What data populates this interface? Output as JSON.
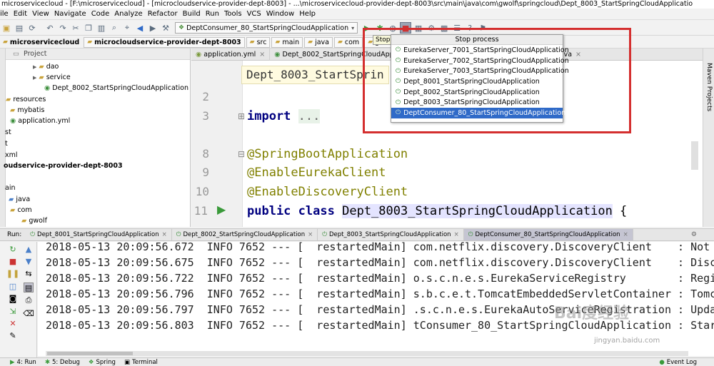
{
  "window": {
    "title": "microservicecloud - [F:\\microservicecloud] - [microcloudservice-provider-dept-8003] - ...\\microservicecloud-provider-dept-8003\\src\\main\\java\\com\\gwolf\\springcloud\\Dept_8003_StartSpringCloudApplicatio"
  },
  "menu": [
    "ile",
    "Edit",
    "View",
    "Navigate",
    "Code",
    "Analyze",
    "Refactor",
    "Build",
    "Run",
    "Tools",
    "VCS",
    "Window",
    "Help"
  ],
  "toolbar": {
    "run_config": "DeptConsumer_80_StartSpringCloudApplication",
    "tooltip": "Stop"
  },
  "navbar": {
    "crumbs": [
      "microservicecloud",
      "microcloudservice-provider-dept-8003",
      "src",
      "main",
      "java",
      "com",
      "gwolf"
    ]
  },
  "project": {
    "header": "Project",
    "tree": [
      "dao",
      "service",
      "Dept_8002_StartSpringCloudApplication",
      "resources",
      "mybatis",
      "application.yml",
      "st",
      "t",
      "xml",
      "oudservice-provider-dept-8003",
      "ain",
      "java",
      "com",
      "gwolf"
    ]
  },
  "editor": {
    "tabs": [
      "application.yml",
      "Dept_8002_StartSpringCloudApplic",
      "ava"
    ],
    "breadcrumb": "Dept_8003_StartSprin",
    "line_numbers": [
      "2",
      "3",
      "8",
      "9",
      "10",
      "11"
    ],
    "code": {
      "import_kw": "import",
      "import_dots": "...",
      "ann1": "@SpringBootApplication",
      "ann2": "@EnableEurekaClient",
      "ann3": "@EnableDiscoveryClient",
      "decl_public": "public",
      "decl_class": "class",
      "decl_name": "Dept_8003_StartSpringCloudApplication",
      "decl_brace": " {"
    }
  },
  "stop_popup": {
    "title": "Stop process",
    "items": [
      "EurekaServer_7001_StartSpringCloudApplication",
      "EurekaServer_7002_StartSpringCloudApplication",
      "EurekaServer_7003_StartSpringCloudApplication",
      "Dept_8001_StartSpringCloudApplication",
      "Dept_8002_StartSpringCloudApplication",
      "Dept_8003_StartSpringCloudApplication",
      "DeptConsumer_80_StartSpringCloudApplication"
    ],
    "selected_index": 6
  },
  "run_panel": {
    "label": "Run:",
    "tabs": [
      "Dept_8001_StartSpringCloudApplication",
      "Dept_8002_StartSpringCloudApplication",
      "Dept_8003_StartSpringCloudApplication",
      "DeptConsumer_80_StartSpringCloudApplication"
    ],
    "active_tab": 3,
    "log": [
      "2018-05-13 20:09:56.672  INFO 7652 --- [  restartedMain] com.netflix.discovery.DiscoveryClient    : Not",
      "2018-05-13 20:09:56.675  INFO 7652 --- [  restartedMain] com.netflix.discovery.DiscoveryClient    : Disc",
      "2018-05-13 20:09:56.722  INFO 7652 --- [  restartedMain] o.s.c.n.e.s.EurekaServiceRegistry        : Regi",
      "2018-05-13 20:09:56.796  INFO 7652 --- [  restartedMain] s.b.c.e.t.TomcatEmbeddedServletContainer : Tomc",
      "2018-05-13 20:09:56.797  INFO 7652 --- [  restartedMain] .s.c.n.e.s.EurekaAutoServiceRegistration : Upda",
      "2018-05-13 20:09:56.803  INFO 7652 --- [  restartedMain] tConsumer_80_StartSpringCloudApplication : Star"
    ]
  },
  "right_strip": "Maven Projects",
  "status": {
    "items": [
      "4: Run",
      "5: Debug",
      "Spring",
      "Terminal"
    ],
    "right": "Event Log"
  },
  "watermark": {
    "main": "Bai度经验",
    "url": "jingyan.baidu.com"
  },
  "colors": {
    "highlight_box": "#d42f2f",
    "selection": "#2f6ac8"
  }
}
